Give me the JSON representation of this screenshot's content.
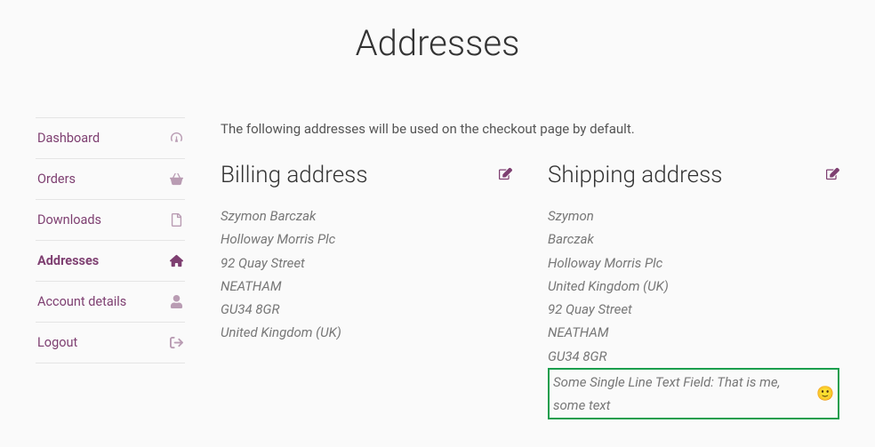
{
  "page": {
    "title": "Addresses"
  },
  "sidebar": {
    "items": [
      {
        "label": "Dashboard",
        "icon": "dashboard-icon",
        "active": false
      },
      {
        "label": "Orders",
        "icon": "basket-icon",
        "active": false
      },
      {
        "label": "Downloads",
        "icon": "file-icon",
        "active": false
      },
      {
        "label": "Addresses",
        "icon": "home-icon",
        "active": true
      },
      {
        "label": "Account details",
        "icon": "user-icon",
        "active": false
      },
      {
        "label": "Logout",
        "icon": "signout-icon",
        "active": false
      }
    ]
  },
  "content": {
    "intro": "The following addresses will be used on the checkout page by default.",
    "billing": {
      "title": "Billing address",
      "lines": [
        "Szymon Barczak",
        "Holloway Morris Plc",
        "92 Quay Street",
        "NEATHAM",
        "GU34 8GR",
        "United Kingdom (UK)"
      ]
    },
    "shipping": {
      "title": "Shipping address",
      "lines": [
        "Szymon",
        "Barczak",
        "Holloway Morris Plc",
        "United Kingdom (UK)",
        "92 Quay Street",
        "NEATHAM",
        "GU34 8GR"
      ],
      "custom_field": {
        "text": "Some Single Line Text Field: That is me, some text",
        "emoji": "🙂"
      }
    }
  }
}
